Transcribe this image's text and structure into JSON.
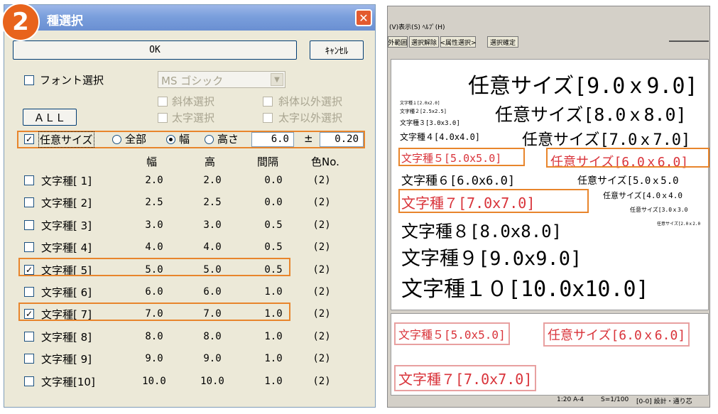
{
  "dialog": {
    "badge": "2",
    "title": "種選択",
    "close_label": "✕",
    "ok_label": "OK",
    "cancel_label": "ｷｬﾝｾﾙ",
    "font_select_label": "フォント選択",
    "font_value": "MS ゴシック",
    "italic_label": "斜体選択",
    "non_italic_label": "斜体以外選択",
    "bold_label": "太字選択",
    "non_bold_label": "太字以外選択",
    "all_label": "ＡＬＬ",
    "custom_size_label": "任意サイズ",
    "radio_all": "全部",
    "radio_width": "幅",
    "radio_height": "高さ",
    "custom_value": "6.0",
    "pm": "±",
    "tolerance": "0.20",
    "col_width": "幅",
    "col_height": "高",
    "col_gap": "間隔",
    "col_color": "色No.",
    "rows": [
      {
        "label": "文字種[ 1]",
        "w": "2.0",
        "h": "2.0",
        "gap": "0.0",
        "color": "(2)",
        "checked": false
      },
      {
        "label": "文字種[ 2]",
        "w": "2.5",
        "h": "2.5",
        "gap": "0.0",
        "color": "(2)",
        "checked": false
      },
      {
        "label": "文字種[ 3]",
        "w": "3.0",
        "h": "3.0",
        "gap": "0.5",
        "color": "(2)",
        "checked": false
      },
      {
        "label": "文字種[ 4]",
        "w": "4.0",
        "h": "4.0",
        "gap": "0.5",
        "color": "(2)",
        "checked": false
      },
      {
        "label": "文字種[ 5]",
        "w": "5.0",
        "h": "5.0",
        "gap": "0.5",
        "color": "(2)",
        "checked": true
      },
      {
        "label": "文字種[ 6]",
        "w": "6.0",
        "h": "6.0",
        "gap": "1.0",
        "color": "(2)",
        "checked": false
      },
      {
        "label": "文字種[ 7]",
        "w": "7.0",
        "h": "7.0",
        "gap": "1.0",
        "color": "(2)",
        "checked": true
      },
      {
        "label": "文字種[ 8]",
        "w": "8.0",
        "h": "8.0",
        "gap": "1.0",
        "color": "(2)",
        "checked": false
      },
      {
        "label": "文字種[ 9]",
        "w": "9.0",
        "h": "9.0",
        "gap": "1.0",
        "color": "(2)",
        "checked": false
      },
      {
        "label": "文字種[10]",
        "w": "10.0",
        "h": "10.0",
        "gap": "1.0",
        "color": "(2)",
        "checked": false
      }
    ]
  },
  "window": {
    "menu": "(V)表示(S) ﾍﾙﾌﾟ(H)",
    "tb_btn1": "外範囲",
    "tb_btn2": "選択解除",
    "tb_btn3": "<属性選択>",
    "tb_btn4": "選択確定",
    "status1": "1:20 A-4",
    "status2": "S=1/100",
    "status3": "[0-0] 設計・通り芯",
    "canvas_texts": {
      "t1": "任意サイズ[9.0ｘ9.0]",
      "t2": "任意サイズ[8.0ｘ8.0]",
      "t3": "任意サイズ[7.0ｘ7.0]",
      "t4": "任意サイズ[6.0ｘ6.0]",
      "t5": "任意サイズ[5.0ｘ5.0",
      "t6": "任意サイズ[4.0ｘ4.0",
      "t7": "任意サイズ[3.0ｘ3.0",
      "t8": "任意サイズ[2.0ｘ2.0",
      "m1": "文字種１[2.0x2.0]",
      "m2": "文字種２[2.5x2.5]",
      "m3": "文字種３[3.0x3.0]",
      "m4": "文字種４[4.0x4.0]",
      "m5": "文字種５[5.0x5.0]",
      "m6": "文字種６[6.0x6.0]",
      "m7": "文字種７[7.0x7.0]",
      "m8": "文字種８[8.0x8.0]",
      "m9": "文字種９[9.0x9.0]",
      "m10": "文字種１０[10.0x10.0]"
    },
    "preview": {
      "p1": "文字種５[5.0x5.0]",
      "p2": "任意サイズ[6.0ｘ6.0]",
      "p3": "文字種７[7.0x7.0]"
    }
  }
}
